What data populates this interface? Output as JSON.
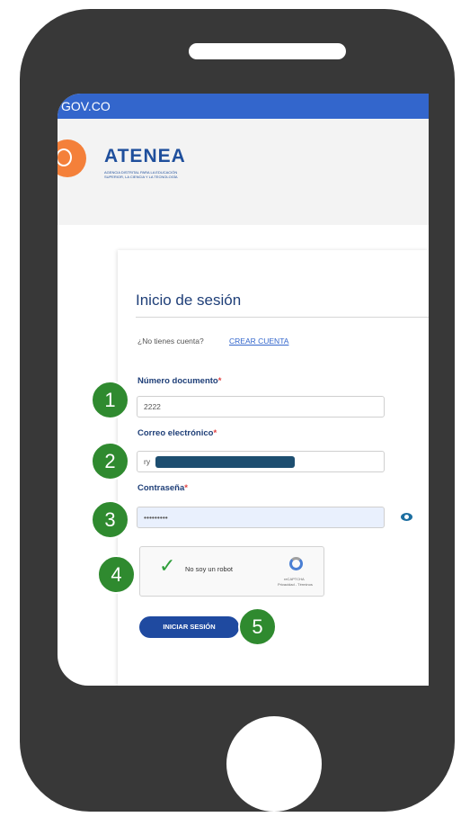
{
  "browser": {
    "gov_bar_text": "GOV.CO"
  },
  "brand": {
    "name": "ATENEA",
    "subtitle_line1": "AGENCIA DISTRITAL PARA LA EDUCACIÓN",
    "subtitle_line2": "SUPERIOR, LA CIENCIA Y LA TECNOLOGÍA"
  },
  "login": {
    "title": "Inicio de sesión",
    "no_account_text": "¿No tienes cuenta?",
    "create_account_link": "CREAR CUENTA",
    "document_label": "Número documento",
    "document_value": "2222",
    "email_label": "Correo electrónico",
    "email_value": "ry",
    "password_label": "Contraseña",
    "password_value": "•••••••••",
    "required_mark": "*",
    "captcha_label": "No soy un robot",
    "captcha_brand": "reCAPTCHA",
    "captcha_links": "Privacidad - Términos",
    "submit_label": "INICIAR SESIÓN"
  },
  "steps": [
    "1",
    "2",
    "3",
    "4",
    "5"
  ],
  "colors": {
    "phone_frame": "#383838",
    "gov_bar": "#3366cc",
    "primary_blue": "#1f4aa0",
    "step_badge": "#2f8a2f",
    "logo_orange": "#f4803a"
  }
}
